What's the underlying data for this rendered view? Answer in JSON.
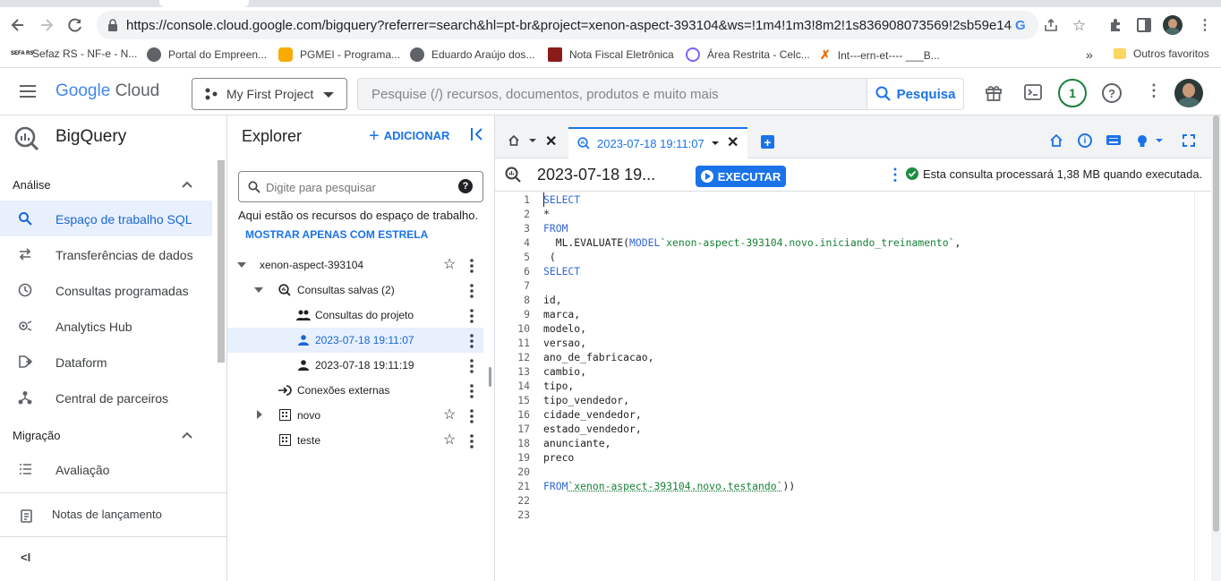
{
  "browser": {
    "url": "https://console.cloud.google.com/bigquery?referrer=search&hl=pt-br&project=xenon-aspect-393104&ws=!1m4!1m3!8m2!1s836908073569!2sb59e1457801...",
    "bookmarks": [
      "Sefaz RS - NF-e - N...",
      "Portal do Empreen...",
      "PGMEI - Programa...",
      "Eduardo Araújo dos...",
      "Nota Fiscal Eletrônica",
      "Área Restrita - Celc...",
      "Int---ern-et---- ___B..."
    ],
    "bookmarks_more": "»",
    "other_favorites": "Outros favoritos",
    "sefaz_badge": "SEFA RS"
  },
  "header": {
    "logo_google": "Google",
    "logo_cloud": "Cloud",
    "project_name": "My First Project",
    "search_placeholder": "Pesquise (/) recursos, documentos, produtos e muito mais",
    "search_button": "Pesquisa",
    "notification_count": "1"
  },
  "leftnav": {
    "product": "BigQuery",
    "section1": "Análise",
    "items": [
      "Espaço de trabalho SQL",
      "Transferências de dados",
      "Consultas programadas",
      "Analytics Hub",
      "Dataform",
      "Central de parceiros"
    ],
    "section2": "Migração",
    "items2": [
      "Avaliação"
    ],
    "release_notes": "Notas de lançamento",
    "collapse": "<I"
  },
  "explorer": {
    "title": "Explorer",
    "add_label": "ADICIONAR",
    "search_placeholder": "Digite para pesquisar",
    "info_text": "Aqui estão os recursos do espaço de trabalho.",
    "starred_link": "MOSTRAR APENAS COM ESTRELA",
    "project": "xenon-aspect-393104",
    "saved_queries": "Consultas salvas (2)",
    "project_queries": "Consultas do projeto",
    "query1": "2023-07-18 19:11:07",
    "query2": "2023-07-18 19:11:19",
    "external_connections": "Conexões externas",
    "dataset1": "novo",
    "dataset2": "teste"
  },
  "editor": {
    "tab_title": "2023-07-18 19:11:07",
    "query_title": "2023-07-18 19...",
    "run_label": "EXECUTAR",
    "status": "Esta consulta processará 1,38 MB quando executada.",
    "line_numbers": [
      "1",
      "2",
      "3",
      "4",
      "5",
      "6",
      "7",
      "8",
      "9",
      "10",
      "11",
      "12",
      "13",
      "14",
      "15",
      "16",
      "17",
      "18",
      "19",
      "20",
      "21",
      "22",
      "23"
    ],
    "code": {
      "l1": "SELECT",
      "l2": "*",
      "l3": "FROM",
      "l4_fn": "  ML.EVALUATE(",
      "l4_kw": "MODEL",
      "l4_str": "`xenon-aspect-393104.novo.iniciando_treinamento`",
      "l4_end": ",",
      "l5": " (",
      "l6": "SELECT",
      "cols": [
        "id,",
        "marca,",
        "modelo,",
        "versao,",
        "ano_de_fabricacao,",
        "cambio,",
        "tipo,",
        "tipo_vendedor,",
        "cidade_vendedor,",
        "estado_vendedor,",
        "anunciante,",
        "preco"
      ],
      "l21_kw": "FROM",
      "l21_str": "`xenon-aspect-393104.novo.testando`",
      "l21_end": "))"
    }
  },
  "colors": {
    "accent": "#1a73e8",
    "active_bg": "#e8f0fe",
    "success": "#188038",
    "run_button": "#1a73e8"
  }
}
